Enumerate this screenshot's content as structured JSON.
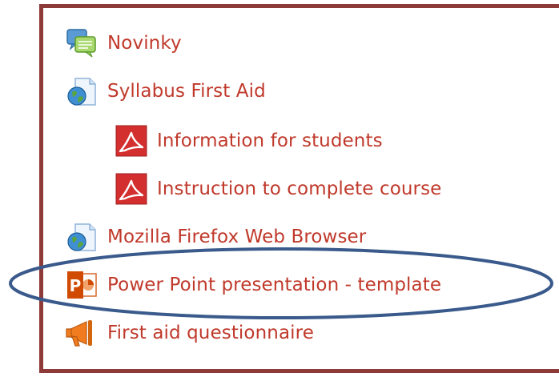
{
  "items": [
    {
      "label": "Novinky",
      "icon": "forum-chat-icon"
    },
    {
      "label": "Syllabus First Aid",
      "icon": "web-page-globe-icon"
    },
    {
      "label": "Information for students",
      "icon": "pdf-file-icon"
    },
    {
      "label": "Instruction to complete course",
      "icon": "pdf-file-icon"
    },
    {
      "label": "Mozilla Firefox Web Browser",
      "icon": "web-page-globe-icon"
    },
    {
      "label": "Power Point presentation - template",
      "icon": "powerpoint-file-icon"
    },
    {
      "label": "First aid questionnaire",
      "icon": "megaphone-feedback-icon"
    }
  ],
  "colors": {
    "link": "#c0392b",
    "frame": "#8d3a38",
    "highlight_ellipse": "#3a5a8c"
  }
}
